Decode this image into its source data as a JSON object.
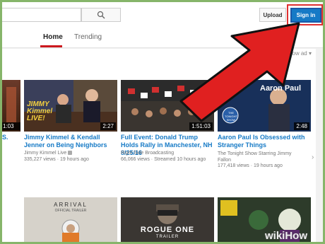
{
  "header": {
    "search_placeholder": "",
    "upload_label": "Upload",
    "signin_label": "Sign in"
  },
  "tabs": [
    {
      "label": "Home"
    },
    {
      "label": "Trending"
    }
  ],
  "feed": {
    "show_ad_label": "Show ad ▾",
    "row1": [
      {
        "partial_title": "S.",
        "duration": "1:03"
      },
      {
        "title": "Jimmy Kimmel & Kendall Jenner on Being Neighbors",
        "channel": "Jimmy Kimmel Live",
        "meta": "335,227 views · 19 hours ago",
        "duration": "2:27",
        "thumb_text": "JIMMY Kimmel LIVE!"
      },
      {
        "title": "Full Event: Donald Trump Holds Rally in Manchester, NH 8/25/16",
        "channel": "Right Side Broadcasting",
        "meta": "66,066 views · Streamed 10 hours ago",
        "duration": "1:51:03"
      },
      {
        "title": "Aaron Paul Is Obsessed with Stranger Things",
        "channel": "The Tonight Show Starring Jimmy Fallon",
        "meta": "177,418 views · 19 hours ago",
        "duration": "2:48",
        "thumb_text": "Aaron Paul",
        "thumb_logo": "THE TONIGHT SHOW"
      }
    ],
    "row2": [
      {
        "thumb_text": "ARRIVAL",
        "thumb_sub": "OFFICIAL TRAILER"
      },
      {
        "thumb_text": "ROGUE ONE",
        "thumb_sub": "TRAILER"
      },
      {
        "thumb_text": ""
      }
    ]
  },
  "watermark": "wikiHow",
  "colors": {
    "brand_red": "#cc181e",
    "link_blue": "#167ac6",
    "annotation_red": "#e03030"
  }
}
